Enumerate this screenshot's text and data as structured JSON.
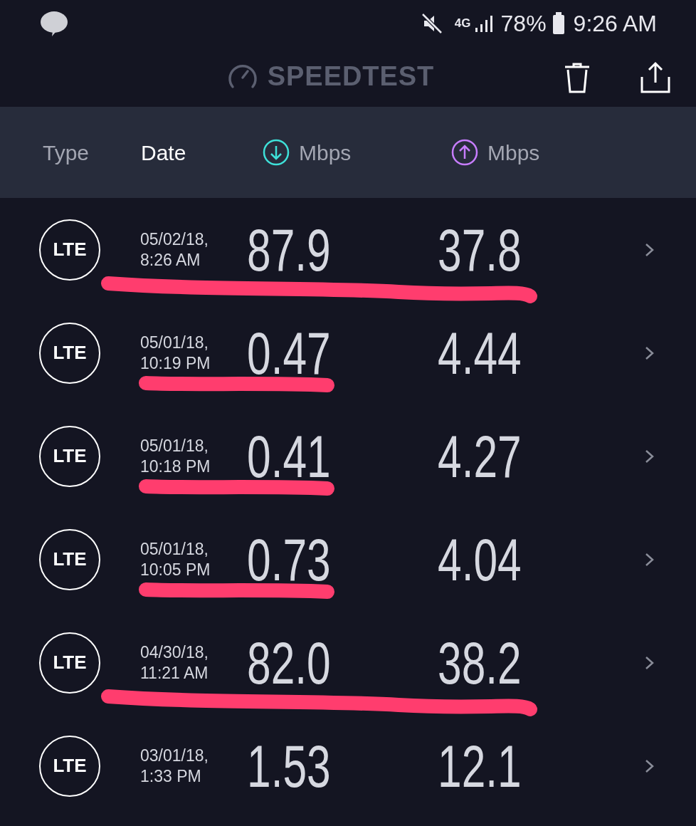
{
  "status_bar": {
    "network": "4G",
    "battery": "78%",
    "time": "9:26 AM"
  },
  "header": {
    "title": "SPEEDTEST"
  },
  "columns": [
    {
      "label": "Type",
      "selected": false
    },
    {
      "label": "Date",
      "selected": true
    },
    {
      "label": "Mbps",
      "kind": "download"
    },
    {
      "label": "Mbps",
      "kind": "upload"
    }
  ],
  "rows": [
    {
      "type": "LTE",
      "date": "05/02/18,",
      "time": "8:26 AM",
      "download": "87.9",
      "upload": "37.8",
      "underlined": true,
      "underline_spans_upload": true
    },
    {
      "type": "LTE",
      "date": "05/01/18,",
      "time": "10:19 PM",
      "download": "0.47",
      "upload": "4.44",
      "underlined": true,
      "underline_spans_upload": false
    },
    {
      "type": "LTE",
      "date": "05/01/18,",
      "time": "10:18 PM",
      "download": "0.41",
      "upload": "4.27",
      "underlined": true,
      "underline_spans_upload": false
    },
    {
      "type": "LTE",
      "date": "05/01/18,",
      "time": "10:05 PM",
      "download": "0.73",
      "upload": "4.04",
      "underlined": true,
      "underline_spans_upload": false
    },
    {
      "type": "LTE",
      "date": "04/30/18,",
      "time": "11:21 AM",
      "download": "82.0",
      "upload": "38.2",
      "underlined": true,
      "underline_spans_upload": true
    },
    {
      "type": "LTE",
      "date": "03/01/18,",
      "time": "1:33 PM",
      "download": "1.53",
      "upload": "12.1",
      "underlined": false,
      "underline_spans_upload": false
    }
  ]
}
